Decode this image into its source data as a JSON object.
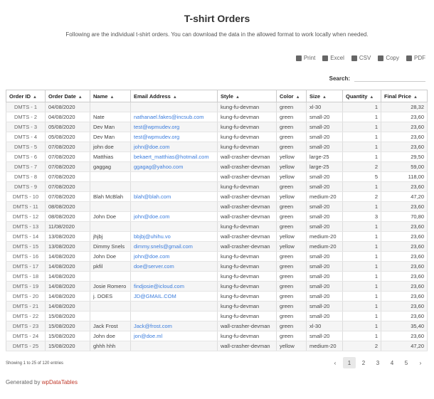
{
  "title": "T-shirt Orders",
  "subtitle": "Following are the individual t-shirt orders. You can download the data in the allowed format to work locally when needed.",
  "exports": [
    {
      "label": "Print",
      "icon": "print-icon"
    },
    {
      "label": "Excel",
      "icon": "excel-icon"
    },
    {
      "label": "CSV",
      "icon": "csv-icon"
    },
    {
      "label": "Copy",
      "icon": "copy-icon"
    },
    {
      "label": "PDF",
      "icon": "pdf-icon"
    }
  ],
  "search": {
    "label": "Search:",
    "value": ""
  },
  "columns": [
    "Order ID",
    "Order Date",
    "Name",
    "Email Address",
    "Style",
    "Color",
    "Size",
    "Quantity",
    "Final Price"
  ],
  "rows": [
    [
      "DMTS - 1",
      "04/08/2020",
      "",
      "",
      "kung-fu-devman",
      "green",
      "xl-30",
      "1",
      "28,32"
    ],
    [
      "DMTS - 2",
      "04/08/2020",
      "Nate",
      "nathanael.fakes@incsub.com",
      "kung-fu-devman",
      "green",
      "small-20",
      "1",
      "23,60"
    ],
    [
      "DMTS - 3",
      "05/08/2020",
      "Dev Man",
      "test@wpmudev.org",
      "kung-fu-devman",
      "green",
      "small-20",
      "1",
      "23,60"
    ],
    [
      "DMTS - 4",
      "05/08/2020",
      "Dev Man",
      "test@wpmudev.org",
      "kung-fu-devman",
      "green",
      "small-20",
      "1",
      "23,60"
    ],
    [
      "DMTS - 5",
      "07/08/2020",
      "john doe",
      "john@doe.com",
      "kung-fu-devman",
      "green",
      "small-20",
      "1",
      "23,60"
    ],
    [
      "DMTS - 6",
      "07/08/2020",
      "Matthias",
      "bekaert_matthias@hotmail.com",
      "wall-crasher-devman",
      "yellow",
      "large-25",
      "1",
      "29,50"
    ],
    [
      "DMTS - 7",
      "07/08/2020",
      "gaggag",
      "ggagag@yahoo.com",
      "wall-crasher-devman",
      "yellow",
      "large-25",
      "2",
      "59,00"
    ],
    [
      "DMTS - 8",
      "07/08/2020",
      "",
      "",
      "wall-crasher-devman",
      "yellow",
      "small-20",
      "5",
      "118,00"
    ],
    [
      "DMTS - 9",
      "07/08/2020",
      "",
      "",
      "kung-fu-devman",
      "green",
      "small-20",
      "1",
      "23,60"
    ],
    [
      "DMTS - 10",
      "07/08/2020",
      "Blah McBlah",
      "blah@blah.com",
      "wall-crasher-devman",
      "yellow",
      "medium-20",
      "2",
      "47,20"
    ],
    [
      "DMTS - 11",
      "08/08/2020",
      "",
      "",
      "wall-crasher-devman",
      "green",
      "small-20",
      "1",
      "23,60"
    ],
    [
      "DMTS - 12",
      "08/08/2020",
      "John Doe",
      "john@doe.com",
      "wall-crasher-devman",
      "green",
      "small-20",
      "3",
      "70,80"
    ],
    [
      "DMTS - 13",
      "11/08/2020",
      "",
      "",
      "kung-fu-devman",
      "green",
      "small-20",
      "1",
      "23,60"
    ],
    [
      "DMTS - 14",
      "13/08/2020",
      "jhjbj",
      "bbjbj@uhihu.vo",
      "wall-crasher-devman",
      "yellow",
      "medium-20",
      "1",
      "23,60"
    ],
    [
      "DMTS - 15",
      "13/08/2020",
      "Dimmy Snels",
      "dimmy.snels@gmail.com",
      "wall-crasher-devman",
      "yellow",
      "medium-20",
      "1",
      "23,60"
    ],
    [
      "DMTS - 16",
      "14/08/2020",
      "John Doe",
      "john@doe.com",
      "kung-fu-devman",
      "green",
      "small-20",
      "1",
      "23,60"
    ],
    [
      "DMTS - 17",
      "14/08/2020",
      "pkfil",
      "doe@server.com",
      "kung-fu-devman",
      "green",
      "small-20",
      "1",
      "23,60"
    ],
    [
      "DMTS - 18",
      "14/08/2020",
      "",
      "",
      "kung-fu-devman",
      "green",
      "small-20",
      "1",
      "23,60"
    ],
    [
      "DMTS - 19",
      "14/08/2020",
      "Josie Romero",
      "findjosie@icloud.com",
      "kung-fu-devman",
      "green",
      "small-20",
      "1",
      "23,60"
    ],
    [
      "DMTS - 20",
      "14/08/2020",
      "j. DOES",
      "JD@GMAIL.COM",
      "kung-fu-devman",
      "green",
      "small-20",
      "1",
      "23,60"
    ],
    [
      "DMTS - 21",
      "14/08/2020",
      "",
      "",
      "kung-fu-devman",
      "green",
      "small-20",
      "1",
      "23,60"
    ],
    [
      "DMTS - 22",
      "15/08/2020",
      "",
      "",
      "kung-fu-devman",
      "green",
      "small-20",
      "1",
      "23,60"
    ],
    [
      "DMTS - 23",
      "15/08/2020",
      "Jack Frost",
      "Jack@frost.com",
      "wall-crasher-devman",
      "green",
      "xl-30",
      "1",
      "35,40"
    ],
    [
      "DMTS - 24",
      "15/08/2020",
      "John doe",
      "jon@doe.ml",
      "kung-fu-devman",
      "green",
      "small-20",
      "1",
      "23,60"
    ],
    [
      "DMTS - 25",
      "15/08/2020",
      "ghhh hhh",
      "",
      "wall-crasher-devman",
      "yellow",
      "medium-20",
      "2",
      "47,20"
    ]
  ],
  "info": "Showing 1 to 25 of 120 entries",
  "pagination": {
    "prev": "‹",
    "pages": [
      "1",
      "2",
      "3",
      "4",
      "5"
    ],
    "next": "›",
    "active": "1"
  },
  "footer": {
    "prefix": "Generated by",
    "brand": "wpDataTables"
  },
  "colors": {
    "link": "#3b7ddd",
    "brand": "#c0392b",
    "stripe": "#f5f5f5"
  }
}
